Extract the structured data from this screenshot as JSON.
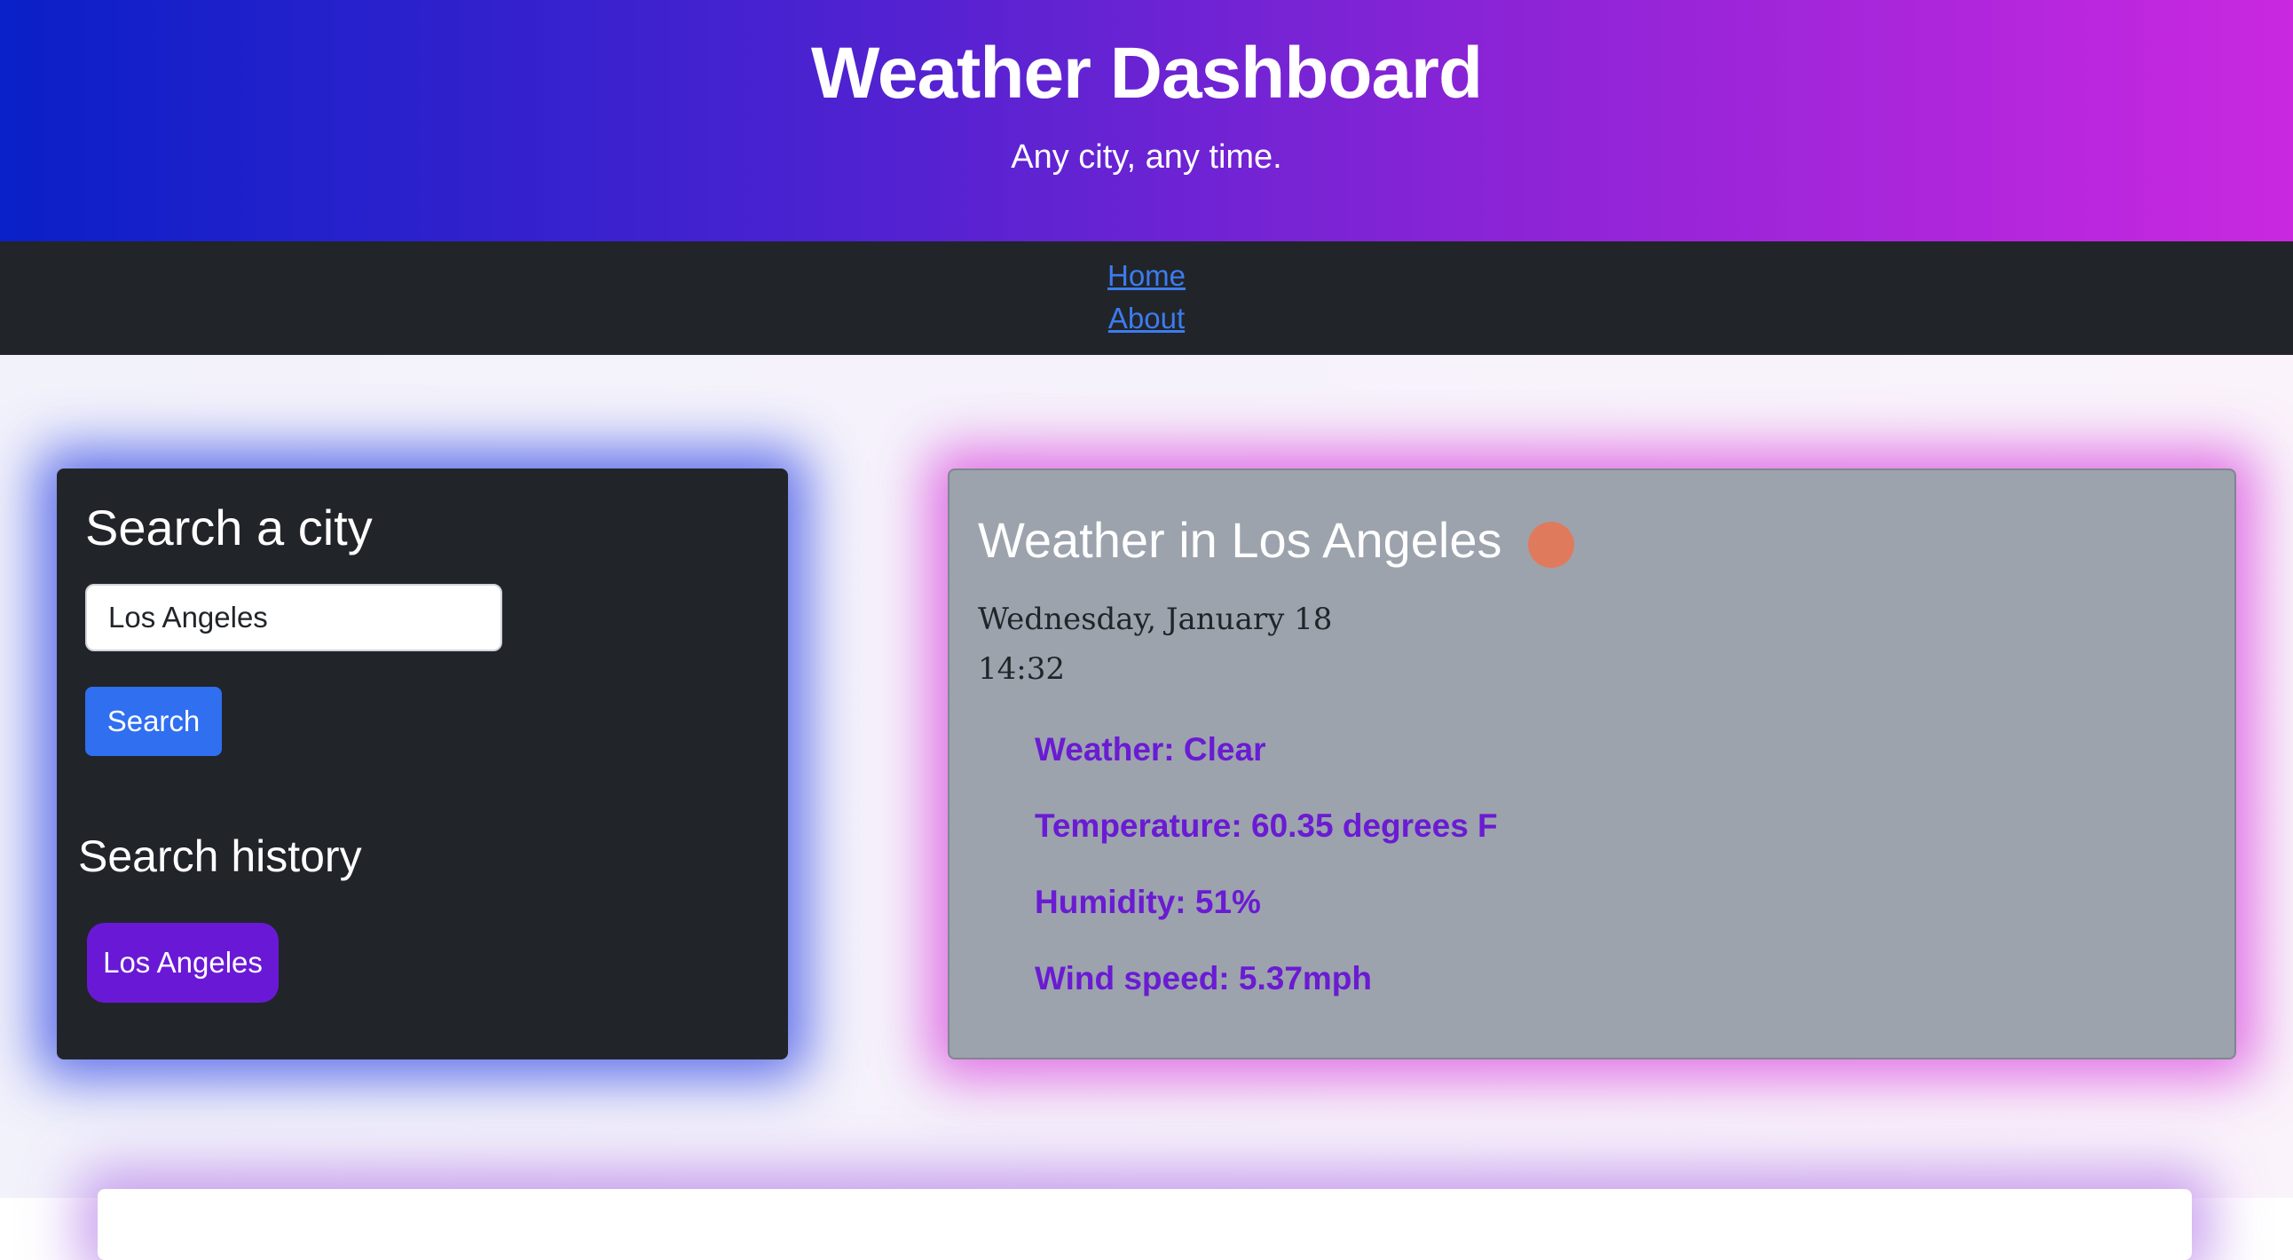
{
  "header": {
    "title": "Weather Dashboard",
    "subtitle": "Any city, any time."
  },
  "nav": {
    "items": [
      {
        "label": "Home"
      },
      {
        "label": "About"
      }
    ],
    "link_color": "#3d7bf0"
  },
  "search": {
    "heading": "Search a city",
    "input_value": "Los Angeles",
    "button_label": "Search",
    "history_heading": "Search history",
    "history": [
      {
        "label": "Los Angeles"
      }
    ]
  },
  "weather": {
    "heading": "Weather in Los Angeles",
    "icon": "weather-status-dot",
    "icon_color": "#e07a5c",
    "date": "Wednesday, January 18",
    "time": "14:32",
    "condition": "Weather: Clear",
    "temperature": "Temperature: 60.35 degrees F",
    "humidity": "Humidity: 51%",
    "wind": "Wind speed: 5.37mph"
  },
  "colors": {
    "header_gradient_start": "#0a20c8",
    "header_gradient_end": "#c928e0",
    "primary_button": "#2f6ff0",
    "history_button": "#6919d6",
    "stat_text": "#6a1bd3"
  }
}
